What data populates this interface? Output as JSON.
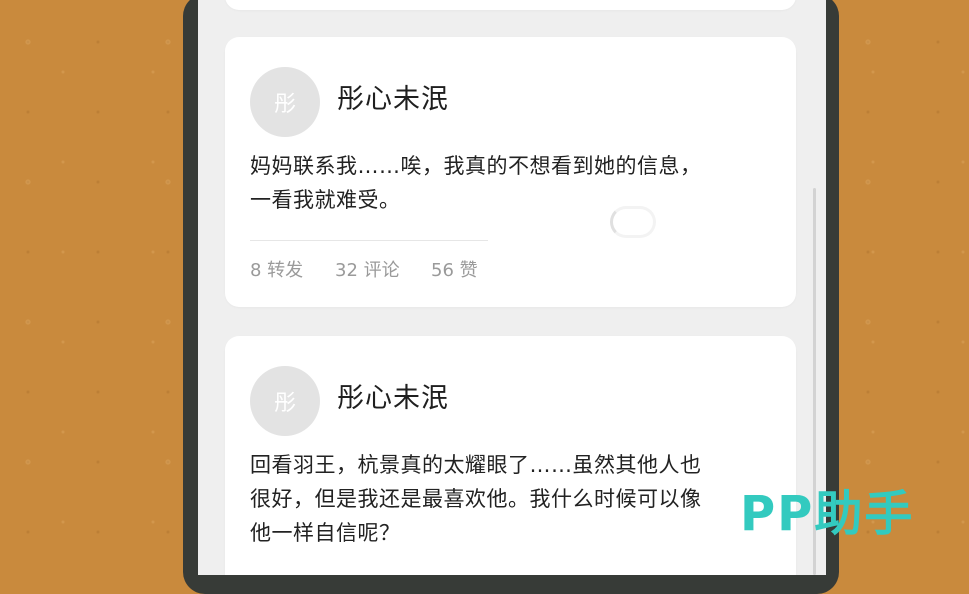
{
  "posts": [
    {
      "avatar_char": "彤",
      "username": "彤心未泯",
      "text_line1": "妈妈联系我……唉，我真的不想看到她的信息，",
      "text_line2": "一看我就难受。",
      "repost": "8 转发",
      "comment": "32 评论",
      "like": "56 赞"
    },
    {
      "avatar_char": "彤",
      "username": "彤心未泯",
      "text_line1": "回看羽王，杭景真的太耀眼了……虽然其他人也",
      "text_line2": "很好，但是我还是最喜欢他。我什么时候可以像",
      "text_line3": "他一样自信呢？"
    }
  ],
  "watermark": "PP助手"
}
